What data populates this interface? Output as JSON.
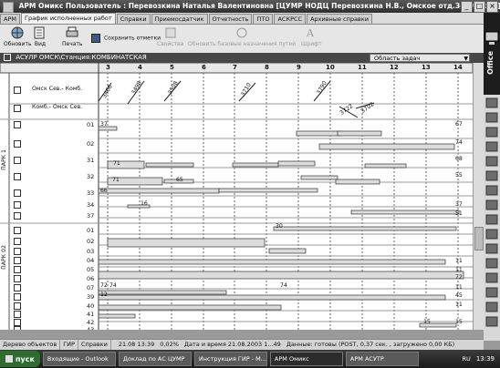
{
  "window": {
    "title": "АРМ Омикс  Пользователь : Перевозкина Наталья Валентиновна [ЦУМР НОДЦ Перевозкина Н.В., Омское отд.З-Сиб ж.д.] Омск"
  },
  "tabs": [
    "АРМ",
    "График исполненных работ",
    "Справки",
    "Приемосдатчик",
    "Отчетность",
    "ПТО",
    "АСКРСС",
    "Архивные справки"
  ],
  "toolbar": {
    "buttons": [
      "Обновить",
      "Вид",
      "Печать",
      "Сохранить отметки",
      "Свойства",
      "Обновить базовые назначения путей",
      "Шрифт"
    ]
  },
  "office_label": "Office",
  "breadcrumb": "АСУЛР ОМСК\\Станция:КОМБИНАТСКАЯ",
  "region_select": "Область задач",
  "hours": [
    "3",
    "4",
    "5",
    "6",
    "7",
    "8",
    "9",
    "10",
    "11",
    "12",
    "13",
    "14"
  ],
  "directions": [
    "Омск Сев.- Комб.",
    "Комб.- Омск Сев."
  ],
  "parks": [
    "ПАРК 1",
    "ПАРК 02"
  ],
  "park1_tracks": [
    "01",
    "02",
    "31",
    "32",
    "33",
    "34",
    "37"
  ],
  "park2_tracks": [
    "01",
    "02",
    "03",
    "04",
    "05",
    "06",
    "07",
    "39",
    "40",
    "41",
    "42",
    "43"
  ],
  "trains": [
    "3466",
    "3498",
    "3508",
    "3710",
    "3790",
    "3722",
    "3702"
  ],
  "left_values": [
    "37",
    "66",
    "71",
    "71",
    "65",
    "30",
    "72",
    "74",
    "74",
    "12",
    "16",
    "15"
  ],
  "right_values": [
    "67",
    "74",
    "68",
    "55",
    "37",
    "51",
    "72",
    "45",
    "15",
    "11",
    "11",
    "11",
    "11"
  ],
  "bottom_tabs": [
    "Дерево объектов",
    "ГИР",
    "Справки"
  ],
  "status": {
    "time": "21.08 13:39",
    "percent": "0,02%",
    "datetime": "Дата и время 21.08.2003 1...49",
    "data_ready": "Данные: готовы (POST, 0,37 сек. , загружено 0,00 КБ)"
  },
  "taskbar": {
    "start": "пуск",
    "tasks": [
      "Входящие - Outlook",
      "Доклад по АС ЦУМР",
      "Инструкция ГИР - М...",
      "АРМ Омикс",
      "АРМ АСУТР"
    ],
    "lang": "RU",
    "clock": "13:39"
  }
}
